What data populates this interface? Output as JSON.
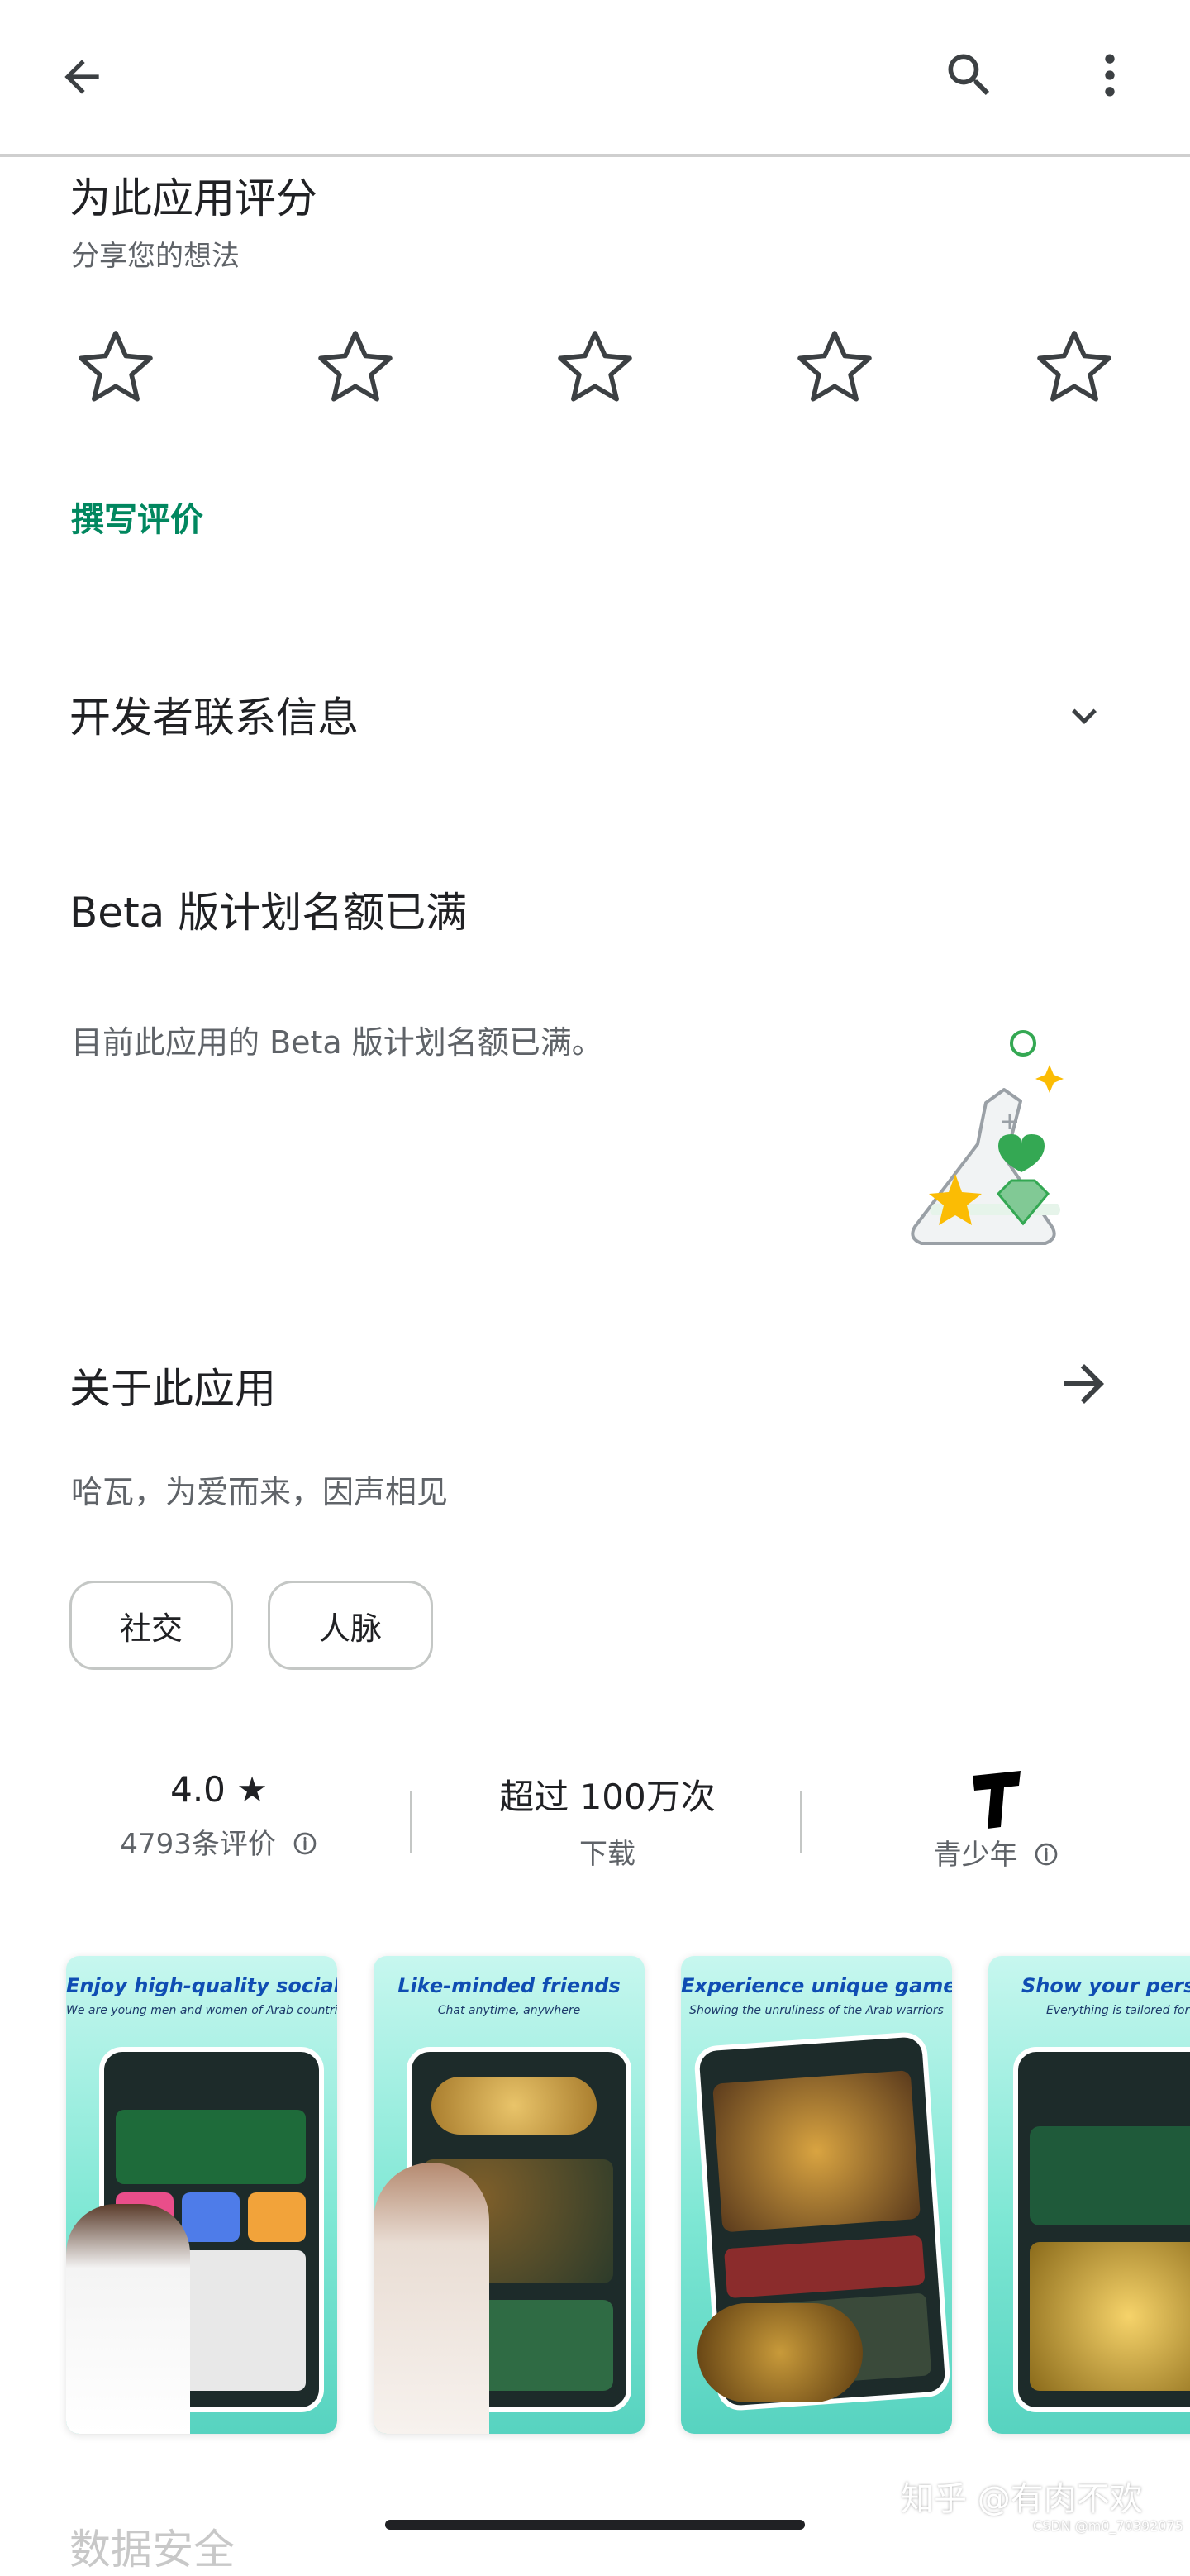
{
  "rating": {
    "title": "为此应用评分",
    "subtitle": "分享您的想法",
    "stars": 5,
    "write_review": "撰写评价"
  },
  "developer": {
    "title": "开发者联系信息"
  },
  "beta": {
    "title": "Beta 版计划名额已满",
    "description": "目前此应用的 Beta 版计划名额已满。"
  },
  "about": {
    "title": "关于此应用",
    "description": "哈瓦，为爱而来，因声相见",
    "tags": [
      "社交",
      "人脉"
    ]
  },
  "stats": {
    "rating_value": "4.0 ★",
    "rating_count": "4793条评价",
    "downloads_value": "超过 100万次",
    "downloads_label": "下载",
    "age_label": "青少年"
  },
  "screenshots": [
    {
      "title": "Enjoy high-quality social",
      "subtitle": "We are young men and women of Arab countrie"
    },
    {
      "title": "Like-minded friends",
      "subtitle": "Chat anytime, anywhere"
    },
    {
      "title": "Experience unique gameplay",
      "subtitle": "Showing the unruliness of the Arab warriors"
    },
    {
      "title": "Show your person",
      "subtitle": "Everything is tailored for y"
    }
  ],
  "next_section_partial": "数据安全",
  "watermark": {
    "main": "知乎 @有肉不欢",
    "small": "CSDN @m0_70392075"
  },
  "colors": {
    "accent_green": "#01875f",
    "text_primary": "#202124",
    "text_secondary": "#5f6368"
  }
}
